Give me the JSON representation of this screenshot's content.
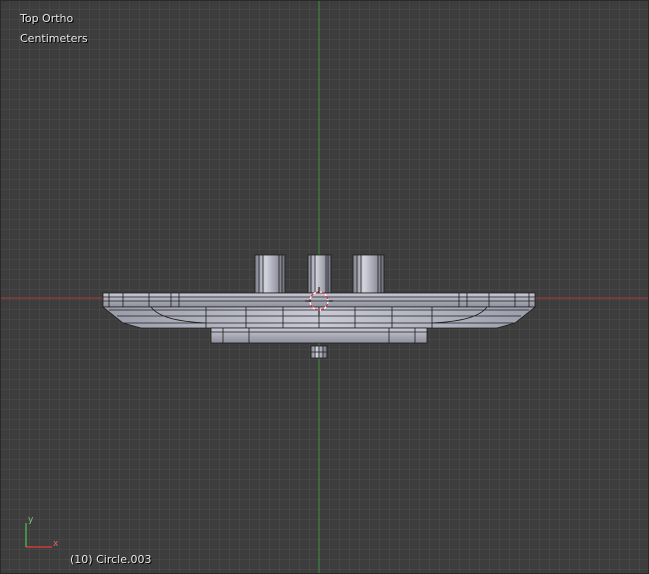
{
  "viewport": {
    "view_name": "Top Ortho",
    "units": "Centimeters",
    "object_info": "(10) Circle.003"
  },
  "axis_gizmo": {
    "x_label": "x",
    "y_label": "y"
  },
  "colors": {
    "background": "#3d3d3d",
    "x_axis": "#c03a3a",
    "y_axis": "#3a8f3a",
    "mesh_fill": "#a6a7b3",
    "mesh_edge": "#1a1a1a",
    "cursor_red": "#e03030",
    "text": "#e8e8e8"
  },
  "icons": {
    "cursor": "3d-cursor-icon",
    "gizmo": "axis-gizmo-icon"
  }
}
